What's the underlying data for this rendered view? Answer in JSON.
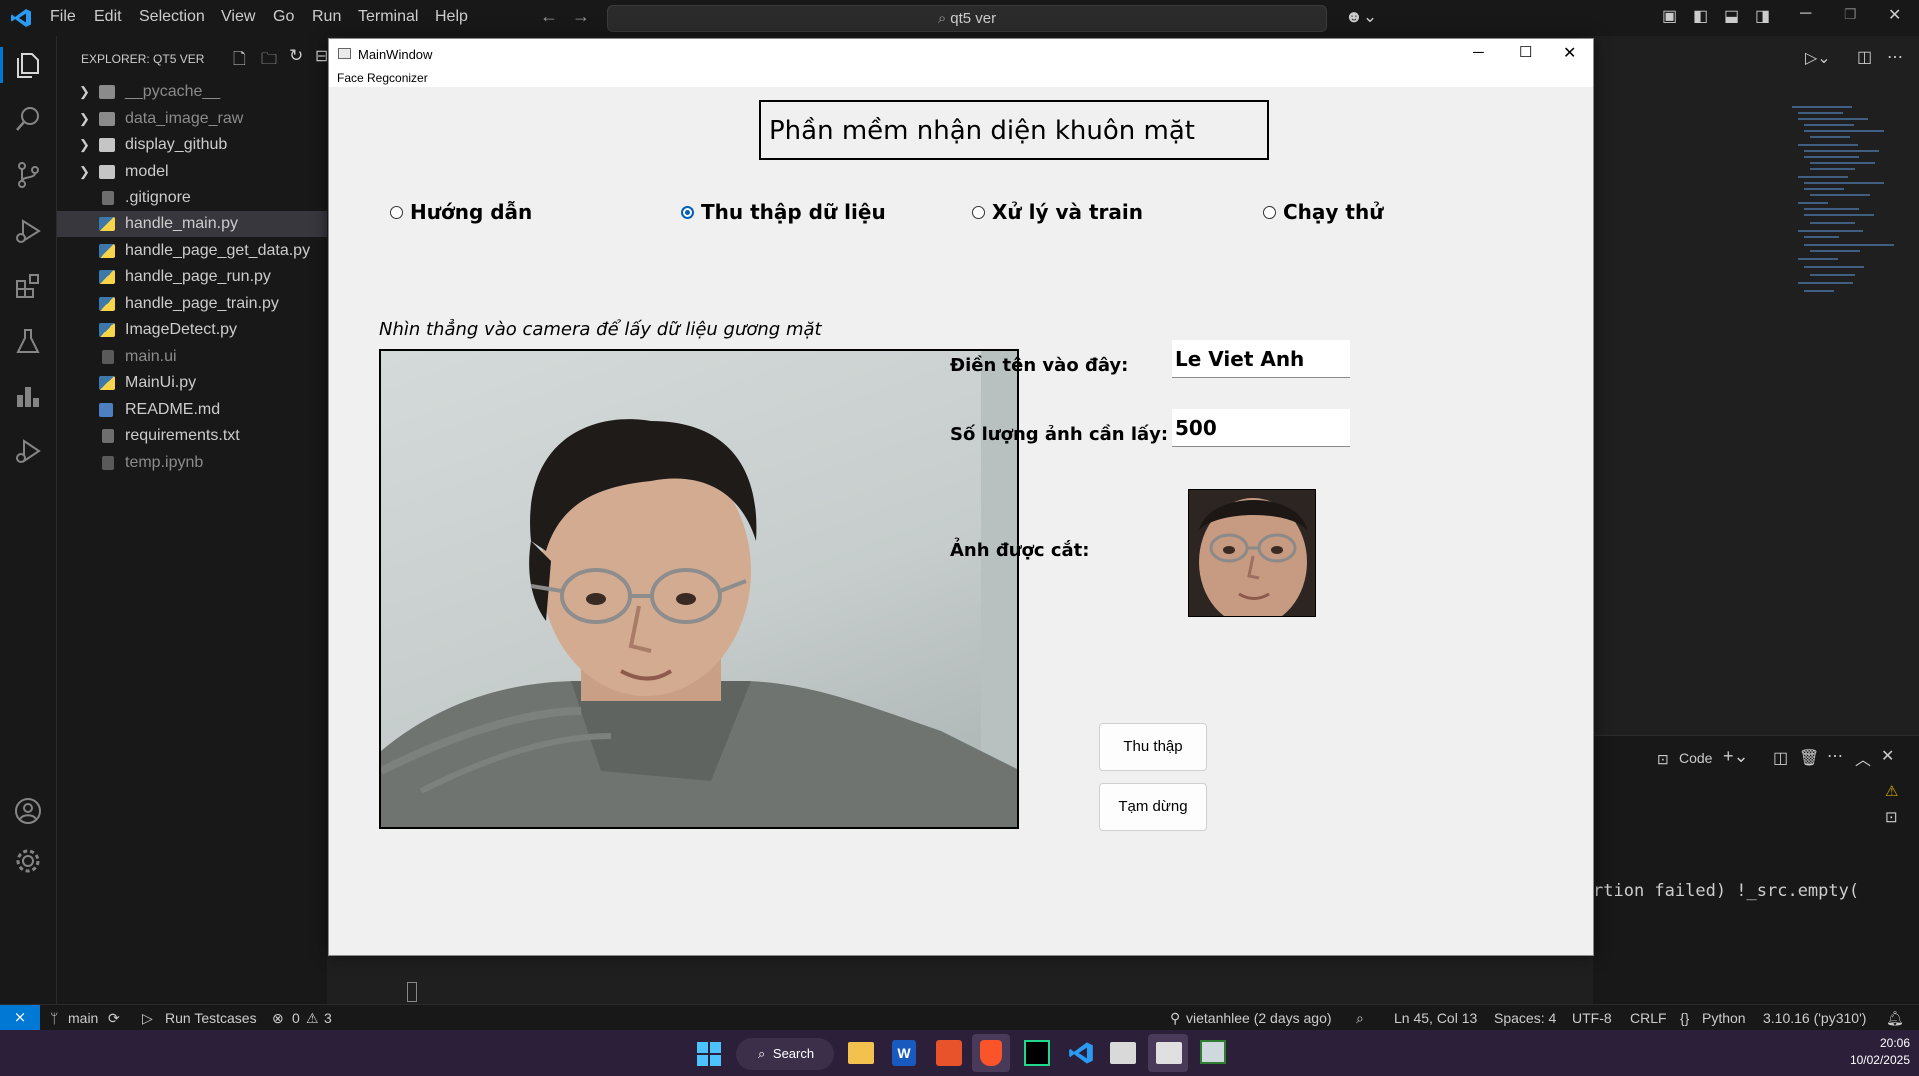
{
  "vscode": {
    "menu": [
      "File",
      "Edit",
      "Selection",
      "View",
      "Go",
      "Run",
      "Terminal",
      "Help"
    ],
    "search_text": "qt5 ver",
    "explorer_title": "EXPLORER: QT5 VER",
    "files": [
      {
        "name": "__pycache__",
        "type": "folder",
        "dim": true
      },
      {
        "name": "data_image_raw",
        "type": "folder",
        "dim": true
      },
      {
        "name": "display_github",
        "type": "folder",
        "dim": false
      },
      {
        "name": "model",
        "type": "folder",
        "dim": false
      },
      {
        "name": ".gitignore",
        "type": "file",
        "dim": false
      },
      {
        "name": "handle_main.py",
        "type": "py",
        "dim": false,
        "selected": true
      },
      {
        "name": "handle_page_get_data.py",
        "type": "py",
        "dim": false
      },
      {
        "name": "handle_page_run.py",
        "type": "py",
        "dim": false
      },
      {
        "name": "handle_page_train.py",
        "type": "py",
        "dim": false
      },
      {
        "name": "ImageDetect.py",
        "type": "py",
        "dim": false
      },
      {
        "name": "main.ui",
        "type": "file",
        "dim": true
      },
      {
        "name": "MainUi.py",
        "type": "py",
        "dim": false
      },
      {
        "name": "README.md",
        "type": "md",
        "dim": false
      },
      {
        "name": "requirements.txt",
        "type": "file",
        "dim": false
      },
      {
        "name": "temp.ipynb",
        "type": "file",
        "dim": true
      }
    ],
    "terminal_label": "Code",
    "terminal_text": "rtion failed) !_src.empty(",
    "status": {
      "branch": "main",
      "run_testcases": "Run Testcases",
      "errors": "0",
      "warnings": "3",
      "git_author": "vietanhlee (2 days ago)",
      "position": "Ln 45, Col 13",
      "spaces": "Spaces: 4",
      "encoding": "UTF-8",
      "eol": "CRLF",
      "language": "Python",
      "interpreter": "3.10.16 ('py310')"
    }
  },
  "taskbar": {
    "search": "Search",
    "time": "20:06",
    "date": "10/02/2025"
  },
  "qt": {
    "window_title": "MainWindow",
    "menu_item": "Face Regconizer",
    "app_title": "Phần mềm nhận diện khuôn mặt",
    "tabs": [
      {
        "label": "Hướng dẫn",
        "checked": false
      },
      {
        "label": "Thu thập dữ liệu",
        "checked": true
      },
      {
        "label": "Xử lý và train",
        "checked": false
      },
      {
        "label": "Chạy thử",
        "checked": false
      }
    ],
    "camera_hint": "Nhìn thẳng vào camera để lấy dữ liệu gương mặt",
    "name_label": "Điền tên vào đây:",
    "name_value": "Le Viet Anh",
    "count_label": "Số lượng ảnh cần lấy:",
    "count_value": "500",
    "cropped_label": "Ảnh được cắt:",
    "collect_button": "Thu thập",
    "pause_button": "Tạm dừng"
  }
}
